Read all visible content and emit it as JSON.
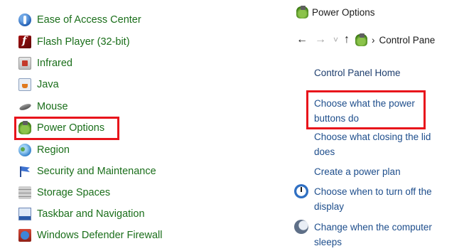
{
  "control_panel_items": [
    {
      "label": "Ease of Access Center",
      "icon": "ease-of-access-icon"
    },
    {
      "label": "Flash Player (32-bit)",
      "icon": "flash-player-icon"
    },
    {
      "label": "Infrared",
      "icon": "infrared-icon"
    },
    {
      "label": "Java",
      "icon": "java-icon"
    },
    {
      "label": "Mouse",
      "icon": "mouse-icon"
    },
    {
      "label": "Power Options",
      "icon": "power-options-icon"
    },
    {
      "label": "Region",
      "icon": "region-globe-icon"
    },
    {
      "label": "Security and Maintenance",
      "icon": "security-flag-icon"
    },
    {
      "label": "Storage Spaces",
      "icon": "storage-spaces-icon"
    },
    {
      "label": "Taskbar and Navigation",
      "icon": "taskbar-icon"
    },
    {
      "label": "Windows Defender Firewall",
      "icon": "firewall-icon"
    }
  ],
  "power_window": {
    "title": "Power Options",
    "breadcrumb": "Control Pane",
    "nav": {
      "back": "←",
      "forward": "→",
      "recent": "˅",
      "up": "↑",
      "separator": "›"
    },
    "home_link": "Control Panel Home",
    "tasks": [
      {
        "label": "Choose what the power buttons do",
        "line1": "Choose what the power",
        "line2": "buttons do"
      },
      {
        "label": "Choose what closing the lid does",
        "line1": "Choose what closing the lid",
        "line2": "does"
      },
      {
        "label": "Create a power plan",
        "line1": "Create a power plan",
        "line2": ""
      },
      {
        "label": "Choose when to turn off the display",
        "line1": "Choose when to turn off the",
        "line2": "display",
        "icon": "display-clock-icon"
      },
      {
        "label": "Change when the computer sleeps",
        "line1": "Change when the computer",
        "line2": "sleeps",
        "icon": "sleep-moon-icon"
      }
    ]
  },
  "colors": {
    "link_green": "#1a6e1a",
    "link_blue": "#1e4e8c",
    "highlight_red": "#e8141b"
  }
}
